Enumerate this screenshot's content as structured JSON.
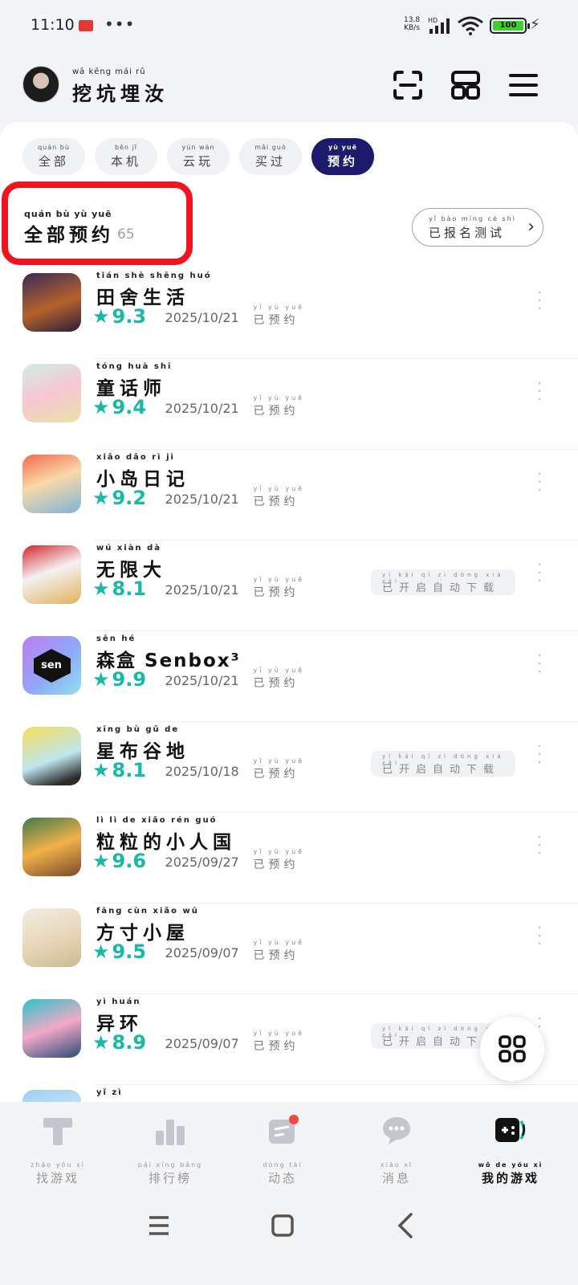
{
  "status_bar": {
    "time": "11:10",
    "dots": "•••",
    "net_speed": "13.8",
    "net_unit": "KB/s",
    "hd": "HD",
    "battery": "100"
  },
  "header": {
    "username_pinyin": "wā kēng mái rǔ",
    "username": "挖坑埋汝"
  },
  "tabs": [
    {
      "pinyin": "quán bù",
      "label": "全部"
    },
    {
      "pinyin": "běn jī",
      "label": "本机"
    },
    {
      "pinyin": "yún wán",
      "label": "云玩"
    },
    {
      "pinyin": "mǎi guò",
      "label": "买过"
    },
    {
      "pinyin": "yù yuē",
      "label": "预约"
    }
  ],
  "section": {
    "title_pinyin": "quán bù yù yuē",
    "title": "全部预约",
    "count": "65",
    "signup_pinyin": "yǐ bào míng cè shì",
    "signup_label": "已报名测试"
  },
  "status_label": {
    "pinyin": "yǐ yù yuē",
    "label": "已预约"
  },
  "auto_download": {
    "pinyin": "yǐ kāi qǐ zì dòng xià zǎi",
    "label": "已开启自动下载"
  },
  "games": [
    {
      "pinyin": "tián shè shēng huó",
      "name": "田舍生活",
      "score": "9.3",
      "date": "2025/10/21",
      "auto": false
    },
    {
      "pinyin": "tóng huà shī",
      "name": "童话师",
      "score": "9.4",
      "date": "2025/10/21",
      "auto": false
    },
    {
      "pinyin": "xiǎo dǎo rì jì",
      "name": "小岛日记",
      "score": "9.2",
      "date": "2025/10/21",
      "auto": false
    },
    {
      "pinyin": "wú xiàn dà",
      "name": "无限大",
      "score": "8.1",
      "date": "2025/10/21",
      "auto": true
    },
    {
      "pinyin": "sēn hé",
      "name": "森盒 Senbox³",
      "score": "9.9",
      "date": "2025/10/21",
      "auto": false
    },
    {
      "pinyin": "xīng bù gǔ de",
      "name": "星布谷地",
      "score": "8.1",
      "date": "2025/10/18",
      "auto": true
    },
    {
      "pinyin": "lì lì de xiǎo rén guó",
      "name": "粒粒的小人国",
      "score": "9.6",
      "date": "2025/09/27",
      "auto": false
    },
    {
      "pinyin": "fāng cùn xiǎo wū",
      "name": "方寸小屋",
      "score": "9.5",
      "date": "2025/09/07",
      "auto": false
    },
    {
      "pinyin": "yì huán",
      "name": "异环",
      "score": "8.9",
      "date": "2025/09/07",
      "auto": true
    },
    {
      "pinyin": "yǐ zì",
      "name": "",
      "score": "",
      "date": "",
      "auto": false
    }
  ],
  "bottom_nav": [
    {
      "pinyin": "zhǎo yóu xì",
      "label": "找游戏",
      "icon": "find-game-icon"
    },
    {
      "pinyin": "pái xíng bǎng",
      "label": "排行榜",
      "icon": "ranking-icon"
    },
    {
      "pinyin": "dòng tài",
      "label": "动态",
      "icon": "feed-icon"
    },
    {
      "pinyin": "xiāo xī",
      "label": "消息",
      "icon": "message-icon"
    },
    {
      "pinyin": "wǒ de yóu xì",
      "label": "我的游戏",
      "icon": "my-games-icon"
    }
  ],
  "colors": {
    "accent": "#19b9a6",
    "active_tab": "#1d1b6e",
    "highlight": "#f0141e"
  }
}
